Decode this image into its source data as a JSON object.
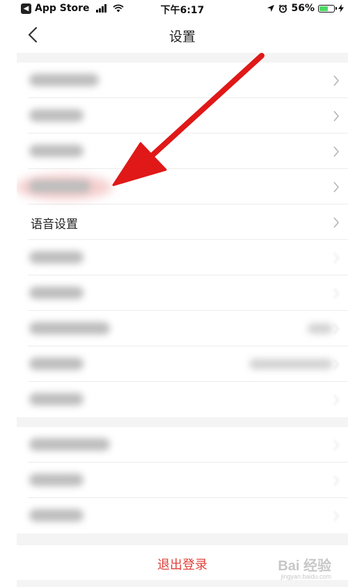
{
  "status_bar": {
    "back_app": "App Store",
    "time": "下午6:17",
    "battery": "56%"
  },
  "nav": {
    "title": "设置"
  },
  "settings": {
    "voice_label": "语音设置"
  },
  "logout": {
    "label": "退出登录"
  },
  "watermark": {
    "brand": "Bai 经验",
    "url": "jingyan.baidu.com"
  },
  "colors": {
    "logout_text": "#e0403a",
    "arrow": "#e01818",
    "battery_fill": "#4cd964"
  }
}
